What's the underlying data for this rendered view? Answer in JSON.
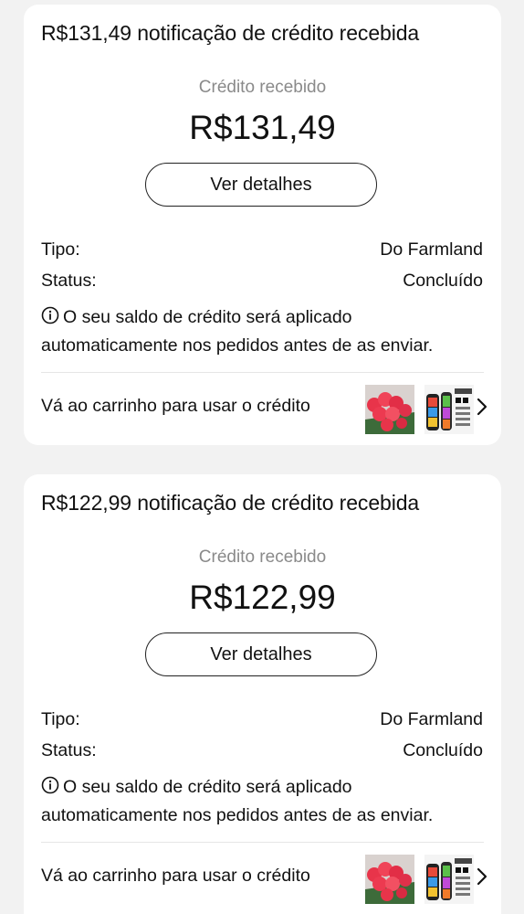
{
  "cards": [
    {
      "title": "R$131,49 notificação de crédito recebida",
      "credit_label": "Crédito recebido",
      "amount": "R$131,49",
      "button_label": "Ver detalhes",
      "tipo_label": "Tipo:",
      "tipo_value": "Do Farmland",
      "status_label": "Status:",
      "status_value": "Concluído",
      "note_line1": "O seu saldo de crédito será aplicado",
      "note_line2": "automaticamente nos pedidos antes de as enviar.",
      "cart_text": "Vá ao carrinho para usar o crédito"
    },
    {
      "title": "R$122,99 notificação de crédito recebida",
      "credit_label": "Crédito recebido",
      "amount": "R$122,99",
      "button_label": "Ver detalhes",
      "tipo_label": "Tipo:",
      "tipo_value": "Do Farmland",
      "status_label": "Status:",
      "status_value": "Concluído",
      "note_line1": "O seu saldo de crédito será aplicado",
      "note_line2": "automaticamente nos pedidos antes de as enviar.",
      "cart_text": "Vá ao carrinho para usar o crédito"
    }
  ],
  "icons": {
    "info": "info-circle-icon",
    "chevron": "chevron-right-icon",
    "thumb1": "roses-product-thumbnail",
    "thumb2": "hair-clipper-product-thumbnail"
  },
  "colors": {
    "background": "#f2f2f2",
    "card": "#ffffff",
    "muted_text": "#8a8a8a",
    "text": "#111111",
    "rose": "#e8344a"
  }
}
